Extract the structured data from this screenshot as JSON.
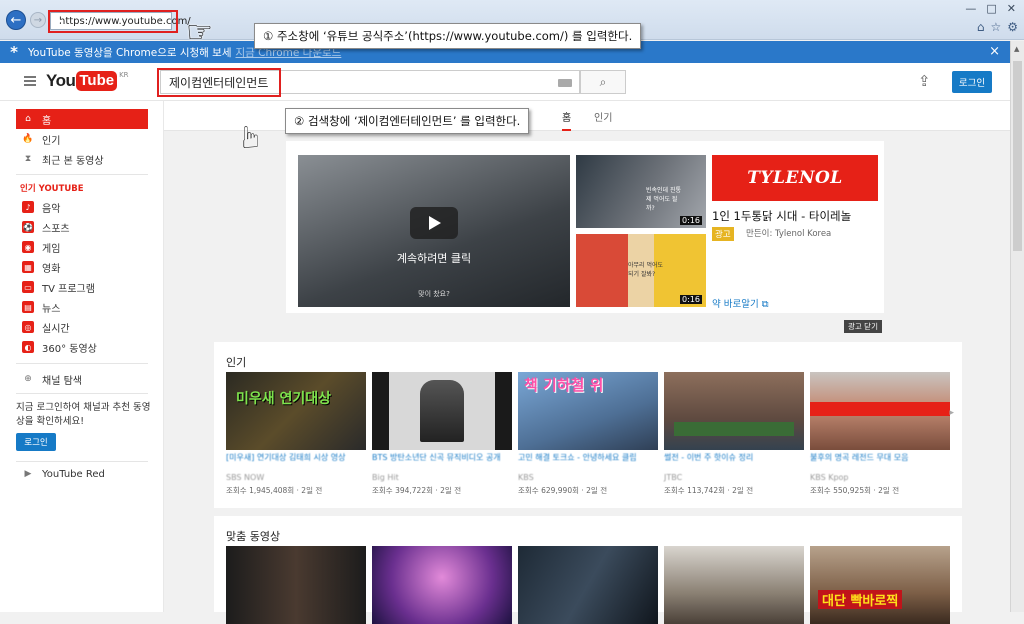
{
  "browser": {
    "url": "https://www.youtube.com/",
    "back_icon": "back-arrow-icon",
    "forward_icon": "forward-arrow-icon"
  },
  "annotations": {
    "step1": "① 주소창에 ‘유튜브 공식주소’(https://www.youtube.com/) 를 입력한다.",
    "step2": "② 검색창에 ‘제이컴엔터테인먼트’ 를 입력한다."
  },
  "promo": {
    "text": "YouTube 동영상을 Chrome으로 시청해 보세",
    "link": "지금 Chrome 다운로드",
    "close": "×"
  },
  "header": {
    "logo_you": "You",
    "logo_tube": "Tube",
    "logo_region": "KR",
    "search_value": "제이컴엔터테인먼트",
    "search_icon": "🔍",
    "login": "로그인"
  },
  "sidebar": {
    "main_items": [
      {
        "label": "홈",
        "icon": "⌂"
      },
      {
        "label": "인기",
        "icon": "🔥"
      },
      {
        "label": "최근 본 동영상",
        "icon": "⧗"
      }
    ],
    "section_title": "인기 YOUTUBE",
    "categories": [
      {
        "label": "음악",
        "icon": "♪"
      },
      {
        "label": "스포츠",
        "icon": "⚽"
      },
      {
        "label": "게임",
        "icon": "◉"
      },
      {
        "label": "영화",
        "icon": "▦"
      },
      {
        "label": "TV 프로그램",
        "icon": "▭"
      },
      {
        "label": "뉴스",
        "icon": "▤"
      },
      {
        "label": "실시간",
        "icon": "◎"
      },
      {
        "label": "360° 동영상",
        "icon": "◐"
      }
    ],
    "browse_channels": "채널 탐색",
    "login_prompt": "지금 로그인하여 채널과 추천 동영상을 확인하세요!",
    "login_button": "로그인",
    "youtube_red": "YouTube Red"
  },
  "tabs": [
    "홈",
    "인기"
  ],
  "ad": {
    "overlay_text": "계속하려면 클릭",
    "sub_text": "맞이 찼요?",
    "thumb1_duration": "0:16",
    "thumb2_duration": "0:16",
    "thumb1_caption": "빈속인데 진통제 먹어도 될까?",
    "thumb2_caption": "아무리 먹어도 되기 잘봐?",
    "brand": "TYLENOL",
    "title": "1인 1두통닭 시대 - 타이레놀",
    "badge": "광고",
    "maker": "만든이: Tylenol Korea",
    "learn_more": "약 바로알기",
    "close_ad": "광고 닫기"
  },
  "popular": {
    "title": "인기",
    "videos": [
      {
        "title": "[미우새] 연기대상 김태희 시상 영상",
        "author": "SBS NOW",
        "meta": "조회수 1,945,408회 · 2일 전",
        "thumb_text": "미우새 연기대상"
      },
      {
        "title": "BTS 방탄소년단 신곡 뮤직비디오 공개",
        "author": "Big Hit",
        "meta": "조회수 394,722회 · 2일 전",
        "thumb_text": ""
      },
      {
        "title": "고민 해결 토크쇼 - 안녕하세요 클립",
        "author": "KBS",
        "meta": "조회수 629,990회 · 2일 전",
        "thumb_text": "책 기하철 위"
      },
      {
        "title": "썰전 - 이번 주 핫이슈 정리",
        "author": "JTBC",
        "meta": "조회수 113,742회 · 2일 전",
        "thumb_text": ""
      },
      {
        "title": "불후의 명곡 레전드 무대 모음",
        "author": "KBS Kpop",
        "meta": "조회수 550,925회 · 2일 전",
        "thumb_text": ""
      }
    ]
  },
  "recommended": {
    "title": "맞춤 동영상",
    "thumb_text": "대단 빡바로찍"
  },
  "colors": {
    "youtube_red": "#e62117",
    "link_blue": "#167ac6",
    "promo_blue": "#2a78c9",
    "highlight_red": "#e0201f"
  }
}
